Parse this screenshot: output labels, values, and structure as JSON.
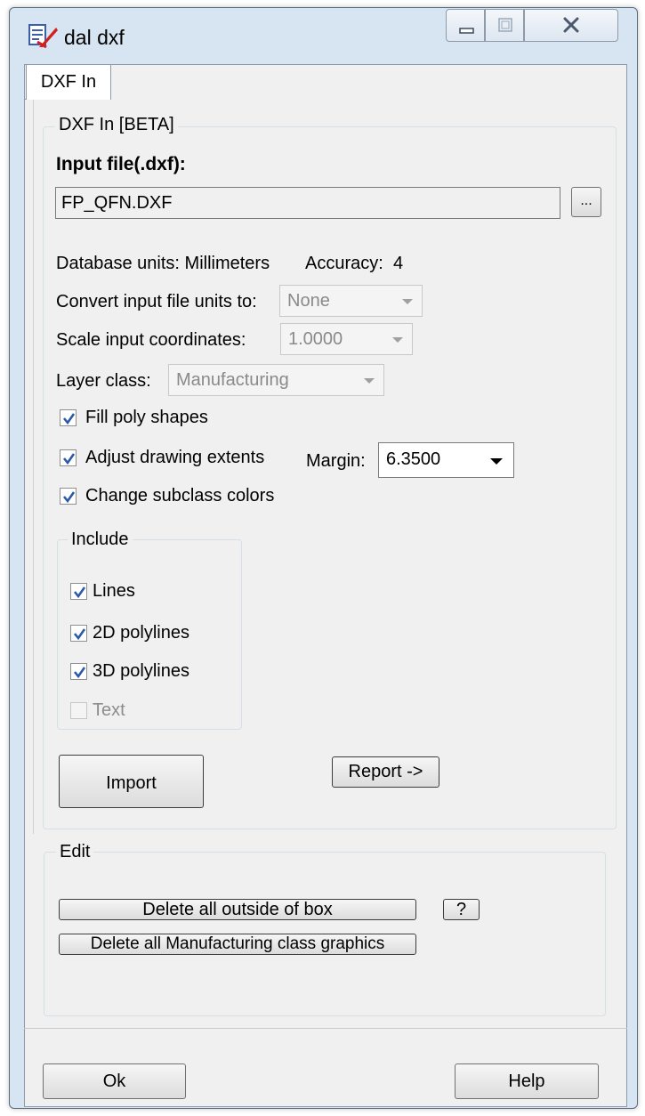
{
  "window": {
    "title": "dal dxf",
    "icons": [
      "app-icon",
      "minimize-icon",
      "maximize-icon",
      "close-icon"
    ]
  },
  "tabs": [
    {
      "label": "DXF In",
      "selected": true
    }
  ],
  "dxf_in": {
    "group_label": "DXF In [BETA]",
    "input_file_label": "Input file(.dxf):",
    "input_file_value": "FP_QFN.DXF",
    "browse_label": "...",
    "db_units_label": "Database units: Millimeters",
    "accuracy_label": "Accuracy:",
    "accuracy_value": "4",
    "convert_label": "Convert input file units to:",
    "convert_value": "None",
    "scale_label": "Scale input coordinates:",
    "scale_value": "1.0000",
    "layer_label": "Layer class:",
    "layer_value": "Manufacturing",
    "fill_poly": {
      "label": "Fill poly shapes",
      "checked": true
    },
    "adjust_extents": {
      "label": "Adjust drawing extents",
      "checked": true
    },
    "margin_label": "Margin:",
    "margin_value": "6.3500",
    "change_colors": {
      "label": "Change subclass colors",
      "checked": true
    },
    "include": {
      "label": "Include",
      "items": [
        {
          "label": "Lines",
          "checked": true,
          "enabled": true
        },
        {
          "label": "2D polylines",
          "checked": true,
          "enabled": true
        },
        {
          "label": "3D polylines",
          "checked": true,
          "enabled": true
        },
        {
          "label": "Text",
          "checked": false,
          "enabled": false
        }
      ]
    },
    "import_label": "Import",
    "report_label": "Report ->"
  },
  "edit": {
    "group_label": "Edit",
    "delete_outside_label": "Delete all outside of box",
    "help_q_label": "?",
    "delete_mfg_label": "Delete all Manufacturing class graphics"
  },
  "footer": {
    "ok_label": "Ok",
    "help_label": "Help"
  },
  "colors": {
    "frame": "#d7e4f2",
    "client": "#f0f0f0",
    "check": "#2b5aa8"
  }
}
